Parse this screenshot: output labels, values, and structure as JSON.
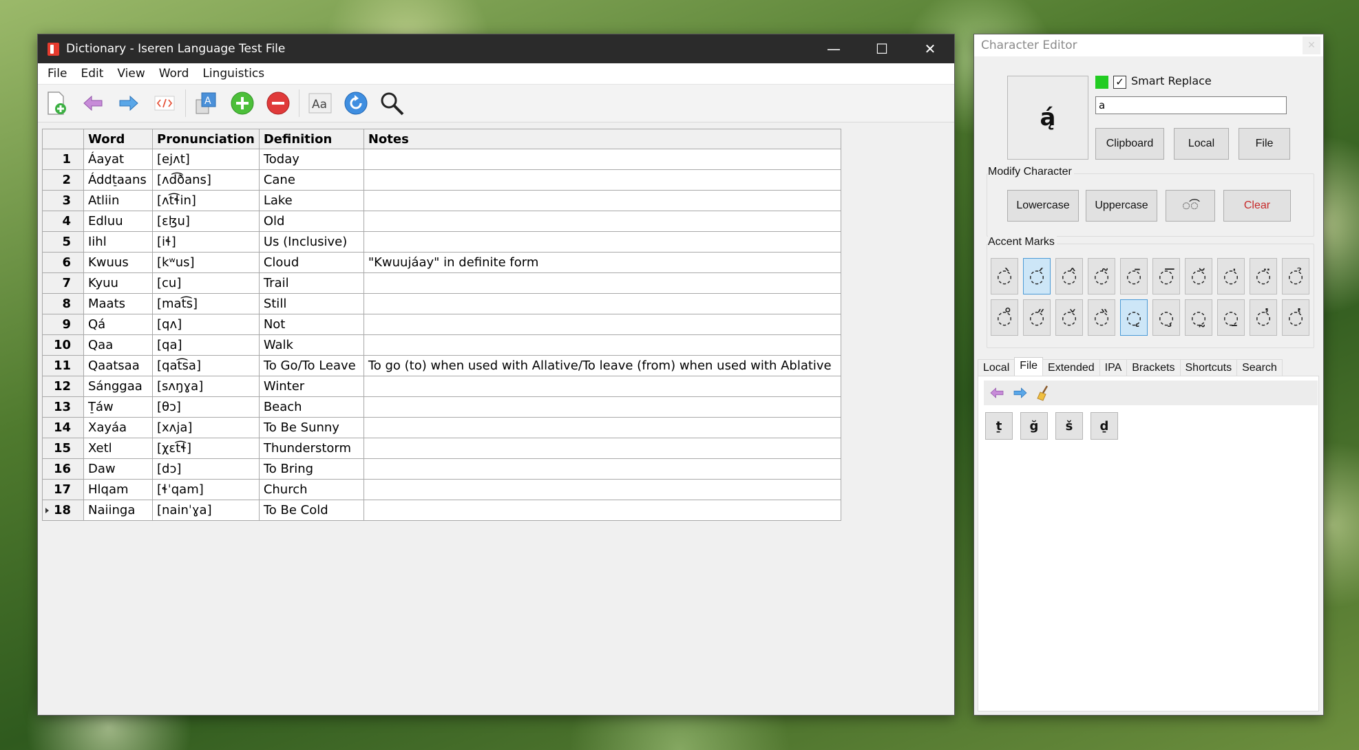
{
  "main_window": {
    "title": "Dictionary - Iseren Language Test File",
    "controls": {
      "minimize": "—",
      "maximize": "☐",
      "close": "✕"
    },
    "menu": [
      "File",
      "Edit",
      "View",
      "Word",
      "Linguistics"
    ],
    "toolbar_icons": [
      "add-entry-icon",
      "back-arrow-icon",
      "forward-arrow-icon",
      "code-icon",
      "font-map-icon",
      "add-icon",
      "remove-icon",
      "text-case-icon",
      "refresh-icon",
      "search-icon"
    ],
    "table": {
      "headers": [
        "",
        "Word",
        "Pronunciation",
        "Definition",
        "Notes"
      ],
      "rows": [
        {
          "n": "1",
          "word": "Áayat",
          "pron": "[ejʌt]",
          "def": "Today",
          "notes": ""
        },
        {
          "n": "2",
          "word": "Áddt̠aans",
          "pron": "[ʌd͡ðans]",
          "def": "Cane",
          "notes": ""
        },
        {
          "n": "3",
          "word": "Atliin",
          "pron": "[ʌt͡ɬin]",
          "def": "Lake",
          "notes": ""
        },
        {
          "n": "4",
          "word": "Edluu",
          "pron": "[ɛɮu]",
          "def": "Old",
          "notes": ""
        },
        {
          "n": "5",
          "word": "Iihl",
          "pron": "[iɬ]",
          "def": "Us (Inclusive)",
          "notes": ""
        },
        {
          "n": "6",
          "word": "Kwuus",
          "pron": "[kʷus]",
          "def": "Cloud",
          "notes": "\"Kwuujáay\" in definite form"
        },
        {
          "n": "7",
          "word": "Kyuu",
          "pron": "[cu]",
          "def": "Trail",
          "notes": ""
        },
        {
          "n": "8",
          "word": "Maats",
          "pron": "[mat͡s]",
          "def": "Still",
          "notes": ""
        },
        {
          "n": "9",
          "word": "Qá",
          "pron": "[qʌ]",
          "def": "Not",
          "notes": ""
        },
        {
          "n": "10",
          "word": "Qaa",
          "pron": "[qa]",
          "def": "Walk",
          "notes": ""
        },
        {
          "n": "11",
          "word": "Qaatsaa",
          "pron": "[qat͡sa]",
          "def": "To Go/To Leave",
          "notes": "To go (to) when used with Allative/To leave (from) when used with Ablative"
        },
        {
          "n": "12",
          "word": "Sánggaa",
          "pron": "[sʌŋɣa]",
          "def": "Winter",
          "notes": ""
        },
        {
          "n": "13",
          "word": "T̠áw",
          "pron": "[θɔ]",
          "def": "Beach",
          "notes": ""
        },
        {
          "n": "14",
          "word": "Xayáa",
          "pron": "[xʌja]",
          "def": "To Be Sunny",
          "notes": ""
        },
        {
          "n": "15",
          "word": "Xetl",
          "pron": "[χɛt͡ɬ]",
          "def": "Thunderstorm",
          "notes": ""
        },
        {
          "n": "16",
          "word": "Daw",
          "pron": "[dɔ]",
          "def": "To Bring",
          "notes": ""
        },
        {
          "n": "17",
          "word": "Hlqam",
          "pron": "[ɬˈqam]",
          "def": "Church",
          "notes": ""
        },
        {
          "n": "18",
          "word": "Naiinga",
          "pron": "[nainˈɣa]",
          "def": "To Be Cold",
          "notes": ""
        }
      ]
    }
  },
  "char_editor": {
    "title": "Character Editor",
    "close": "✕",
    "preview_char": "ą́",
    "smart_replace_label": "Smart Replace",
    "smart_replace_checked": "✓",
    "input_value": "a",
    "source_buttons": [
      "Clipboard",
      "Local",
      "File"
    ],
    "modify_label": "Modify Character",
    "modify_buttons": [
      "Lowercase",
      "Uppercase",
      "◌͡◌",
      "Clear"
    ],
    "accent_label": "Accent Marks",
    "accent_row1": [
      "◌̀",
      "◌́",
      "◌̂",
      "◌̃",
      "◌̄",
      "◌̅",
      "◌̆",
      "◌̇",
      "◌̈",
      "◌̉"
    ],
    "accent_row2": [
      "◌̊",
      "◌̋",
      "◌̌",
      "◌̏",
      "◌̨",
      "◌̧",
      "◌̰",
      "◌̱",
      "◌̓",
      "◌̔"
    ],
    "tabs": [
      "Local",
      "File",
      "Extended",
      "IPA",
      "Brackets",
      "Shortcuts",
      "Search"
    ],
    "active_tab": "File",
    "file_chars": [
      "t̠",
      "ğ",
      "š",
      "d̠"
    ],
    "colors": {
      "indicator": "#22cc22",
      "clear_text": "#c62828",
      "selected_accent": "#cde6f7"
    }
  }
}
